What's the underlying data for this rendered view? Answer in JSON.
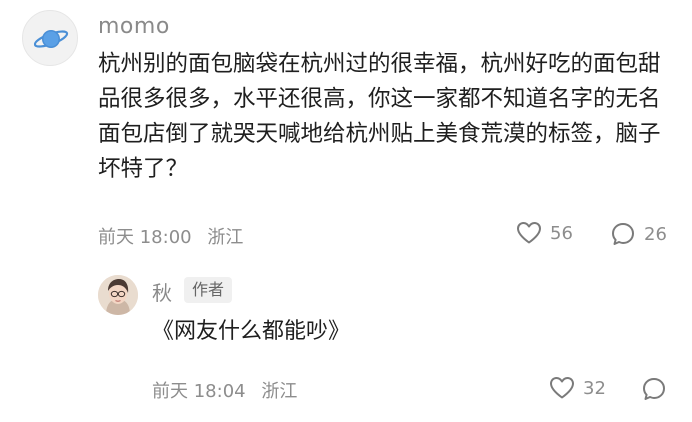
{
  "comment": {
    "username": "momo",
    "avatar_icon": "planet-icon",
    "text": "杭州别的面包脑袋在杭州过的很幸福，杭州好吃的面包甜品很多很多，水平还很高，你这一家都不知道名字的无名面包店倒了就哭天喊地给杭州贴上美食荒漠的标签，脑子坏特了？",
    "time": "前天 18:00",
    "location": "浙江",
    "likes": "56",
    "replies": "26"
  },
  "reply": {
    "username": "秋",
    "badge": "作者",
    "text": "《网友什么都能吵》",
    "time": "前天 18:04",
    "location": "浙江",
    "likes": "32"
  }
}
